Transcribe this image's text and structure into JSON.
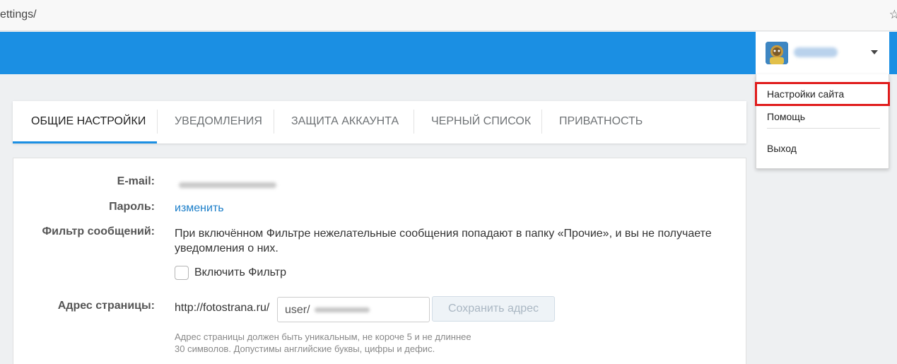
{
  "browser": {
    "url": "ettings/",
    "star_icon": "star-icon"
  },
  "header": {
    "user_menu": {
      "avatar_icon": "avatar",
      "caret_icon": "chevron-down-icon",
      "items": [
        "Настройки сайта",
        "Помощь",
        "Выход"
      ]
    }
  },
  "tabs": [
    {
      "label": "ОБЩИЕ НАСТРОЙКИ",
      "active": true
    },
    {
      "label": "УВЕДОМЛЕНИЯ",
      "active": false
    },
    {
      "label": "ЗАЩИТА АККАУНТА",
      "active": false
    },
    {
      "label": "ЧЕРНЫЙ СПИСОК",
      "active": false
    },
    {
      "label": "ПРИВАТНОСТЬ",
      "active": false
    }
  ],
  "settings": {
    "email_label": "E-mail:",
    "password_label": "Пароль:",
    "password_link": "изменить",
    "filter_label": "Фильтр сообщений:",
    "filter_desc": "При включённом Фильтре нежелательные сообщения попадают в папку «Прочие», и вы не получаете уведомления о них.",
    "filter_checkbox_label": "Включить Фильтр",
    "filter_checked": false,
    "address_label": "Адрес страницы:",
    "address_prefix": "http://fotostrana.ru/",
    "address_value": "user/",
    "save_button": "Сохранить адрес",
    "address_hint_line1": "Адрес страницы должен быть уникальным, не короче 5 и не длиннее",
    "address_hint_line2": "30 символов. Допустимы английские буквы, цифры и дефис."
  },
  "colors": {
    "header_blue": "#1b8fe3",
    "link_blue": "#1b7ec9",
    "highlight_red": "#e01b1b"
  }
}
